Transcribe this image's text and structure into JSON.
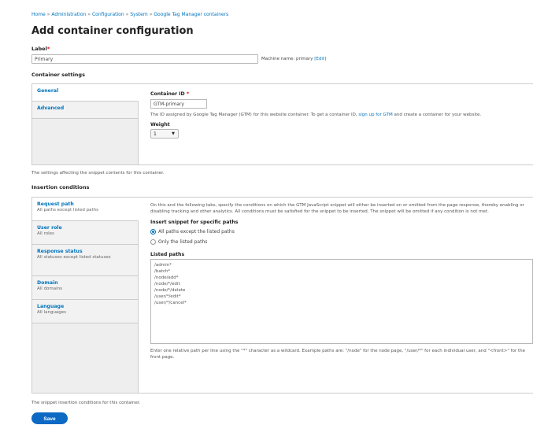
{
  "breadcrumb": [
    "Home",
    "Administration",
    "Configuration",
    "System",
    "Google Tag Manager containers"
  ],
  "page_title": "Add container configuration",
  "label_field": {
    "label": "Label",
    "value": "Primary",
    "machine_name_text": "Machine name: primary",
    "edit_link": "[Edit]"
  },
  "container_settings": {
    "title": "Container settings",
    "tabs": [
      {
        "title": "General"
      },
      {
        "title": "Advanced"
      }
    ],
    "container_id": {
      "label": "Container ID",
      "value": "GTM-primary",
      "desc_prefix": "The ID assigned by Google Tag Manager (GTM) for this website container. To get a container ID,",
      "desc_link": "sign up for GTM",
      "desc_suffix": "and create a container for your website."
    },
    "weight": {
      "label": "Weight",
      "value": "1"
    },
    "footer_note": "The settings affecting the snippet contents for this container."
  },
  "insertion": {
    "title": "Insertion conditions",
    "tabs": [
      {
        "title": "Request path",
        "summary": "All paths except listed paths"
      },
      {
        "title": "User role",
        "summary": "All roles"
      },
      {
        "title": "Response status",
        "summary": "All statuses except listed statuses"
      },
      {
        "title": "Domain",
        "summary": "All domains"
      },
      {
        "title": "Language",
        "summary": "All languages"
      }
    ],
    "intro": "On this and the following tabs, specify the conditions on which the GTM JavaScript snippet will either be inserted on or omitted from the page response, thereby enabling or disabling tracking and other analytics. All conditions must be satisfied for the snippet to be inserted. The snippet will be omitted if any condition is not met.",
    "paths_heading": "Insert snippet for specific paths",
    "radio_all": "All paths except the listed paths",
    "radio_only": "Only the listed paths",
    "listed_paths_label": "Listed paths",
    "listed_paths": [
      "/admin*",
      "/batch*",
      "/node/add*",
      "/node/*/edit",
      "/node/*/delete",
      "/user/*/edit*",
      "/user/*/cancel*"
    ],
    "paths_help": "Enter one relative path per line using the \"*\" character as a wildcard. Example paths are: \"/node\" for the node page, \"/user/*\" for each individual user, and \"<front>\" for the front page.",
    "footer_note": "The snippet insertion conditions for this container."
  },
  "save_label": "Save"
}
